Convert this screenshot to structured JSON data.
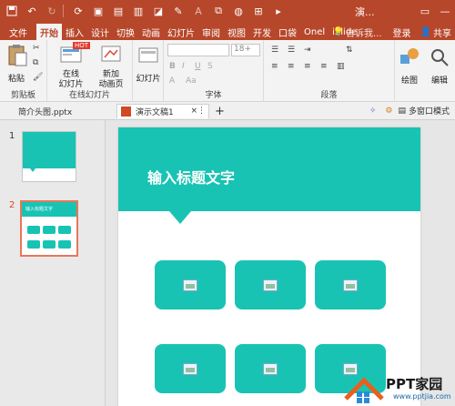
{
  "window": {
    "title": "演..."
  },
  "tabs": [
    "文件",
    "开始",
    "插入",
    "设计",
    "切换",
    "动画",
    "幻灯片",
    "审阅",
    "视图",
    "开发",
    "口袋",
    "Onel",
    "iSlide"
  ],
  "tabs_right": {
    "tell": "告诉我...",
    "login": "登录",
    "share": "共享"
  },
  "ribbon": {
    "paste": "粘贴",
    "clipboard_group": "剪贴板",
    "online_slide": "在线\n幻灯片",
    "online_badge": "HOT",
    "new_anim": "新加\n动画页",
    "online_group": "在线幻灯片",
    "slides_btn": "幻灯片",
    "font_size": "18+",
    "font_group": "字体",
    "para_group": "段落",
    "draw": "绘图",
    "edit": "编辑"
  },
  "doc_tabs": {
    "tab1": "简介头图.pptx",
    "tab2": "演示文稿1",
    "multi": "多窗口模式"
  },
  "thumbs": {
    "n1": "1",
    "n2": "2",
    "mini_title": "输入标题文字"
  },
  "slide": {
    "title": "输入标题文字"
  },
  "watermark": {
    "brand": "PPT家园",
    "url": "www.pptjia.com"
  },
  "colors": {
    "accent": "#b7472a",
    "teal": "#19c3b4",
    "thumb_sel": "#e8775a"
  }
}
